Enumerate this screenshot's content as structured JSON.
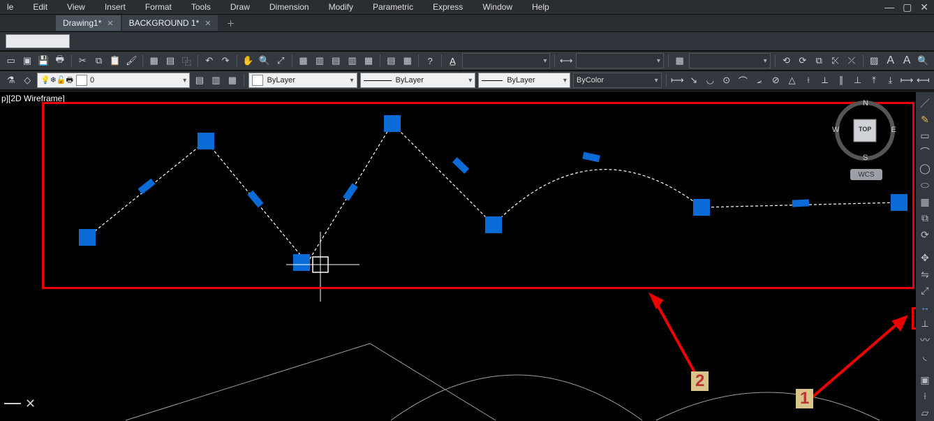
{
  "menus": [
    "le",
    "Edit",
    "View",
    "Insert",
    "Format",
    "Tools",
    "Draw",
    "Dimension",
    "Modify",
    "Parametric",
    "Express",
    "Window",
    "Help"
  ],
  "tabs": [
    {
      "label": "Drawing1*",
      "active": true
    },
    {
      "label": "BACKGROUND 1*",
      "active": false
    }
  ],
  "layer_value": "0",
  "linetype_layer": "ByLayer",
  "linetype_styleA": "ByLayer",
  "linetype_styleB": "ByLayer",
  "bycolor": "ByColor",
  "view_label": "p][2D Wireframe]",
  "cube": {
    "top": "TOP",
    "n": "N",
    "s": "S",
    "e": "E",
    "w": "W"
  },
  "wcs": "WCS",
  "anno1": "1",
  "anno2": "2"
}
